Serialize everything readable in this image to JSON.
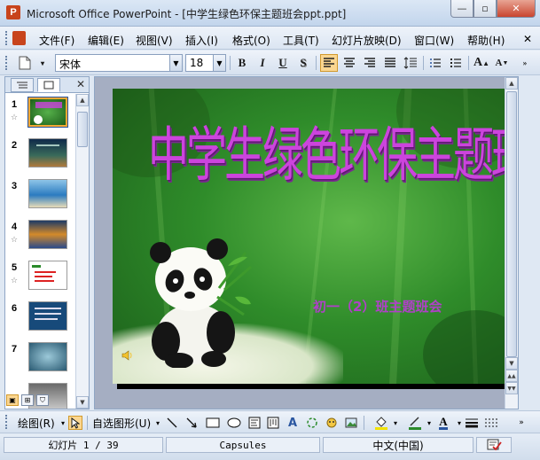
{
  "window": {
    "title": "Microsoft Office PowerPoint - [中学生绿色环保主题班会ppt.ppt]",
    "app_icon_letter": "P",
    "minimize_glyph": "—",
    "restore_glyph": "▫",
    "close_glyph": "✕"
  },
  "menu": {
    "items": [
      {
        "label": "文件(F)"
      },
      {
        "label": "编辑(E)"
      },
      {
        "label": "视图(V)"
      },
      {
        "label": "插入(I)"
      },
      {
        "label": "格式(O)"
      },
      {
        "label": "工具(T)"
      },
      {
        "label": "幻灯片放映(D)"
      },
      {
        "label": "窗口(W)"
      },
      {
        "label": "帮助(H)"
      }
    ],
    "close_glyph": "✕"
  },
  "toolbar": {
    "font_name": "宋体",
    "font_size": "18",
    "bold": "B",
    "italic": "I",
    "underline": "U",
    "shadow": "S",
    "align_left_active": true
  },
  "slides_pane": {
    "close_glyph": "✕",
    "slide_numbers": [
      "1",
      "2",
      "3",
      "4",
      "5",
      "6",
      "7"
    ],
    "selected_slide": 1
  },
  "slide": {
    "title": "中学生绿色环保主题班会ppt",
    "subtitle": "初一（2）班主题班会",
    "title_color": "#cc44dd",
    "subtitle_color": "#b040c8"
  },
  "drawing_toolbar": {
    "draw_label": "绘图(R)",
    "autoshapes_label": "自选图形(U)"
  },
  "status": {
    "slide_counter": "幻灯片 1 / 39",
    "design": "Capsules",
    "language": "中文(中国)"
  }
}
